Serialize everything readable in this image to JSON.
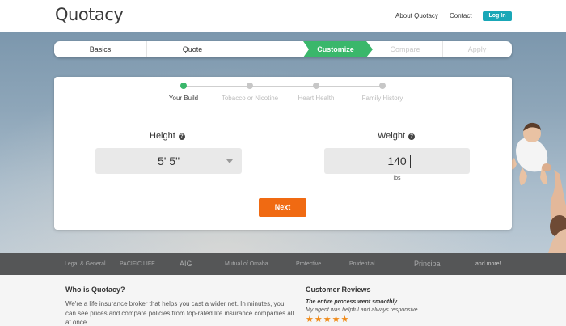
{
  "header": {
    "logo": "Quotacy",
    "nav": [
      "About Quotacy",
      "Contact"
    ],
    "login_label": "Log In"
  },
  "steps": {
    "items": [
      "Basics",
      "Quote",
      "Customize",
      "Compare",
      "Apply"
    ],
    "active": "Customize",
    "active_color": "#3ab76b"
  },
  "card": {
    "tracker": [
      "Your Build",
      "Tobacco or Nicotine",
      "Heart Health",
      "Family History"
    ],
    "height": {
      "label": "Height",
      "value": "5' 5\""
    },
    "weight": {
      "label": "Weight",
      "value": "140",
      "unit": "lbs"
    },
    "help_glyph": "?",
    "next_label": "Next",
    "next_color": "#f06a12"
  },
  "partners": [
    "Legal & General",
    "PACIFIC LIFE",
    "AIG",
    "Mutual of Omaha",
    "Protective",
    "Prudential",
    "Principal",
    "and more!"
  ],
  "about": {
    "title": "Who is Quotacy?",
    "text": "We're a life insurance broker that helps you cast a wider net. In minutes, you can see prices and compare policies from top-rated life insurance companies all at once."
  },
  "reviews": {
    "title": "Customer Reviews",
    "headline": "The entire process went smoothly",
    "body": "My agent was helpful and always responsive.",
    "stars": "★★★★★",
    "rating": 5
  }
}
